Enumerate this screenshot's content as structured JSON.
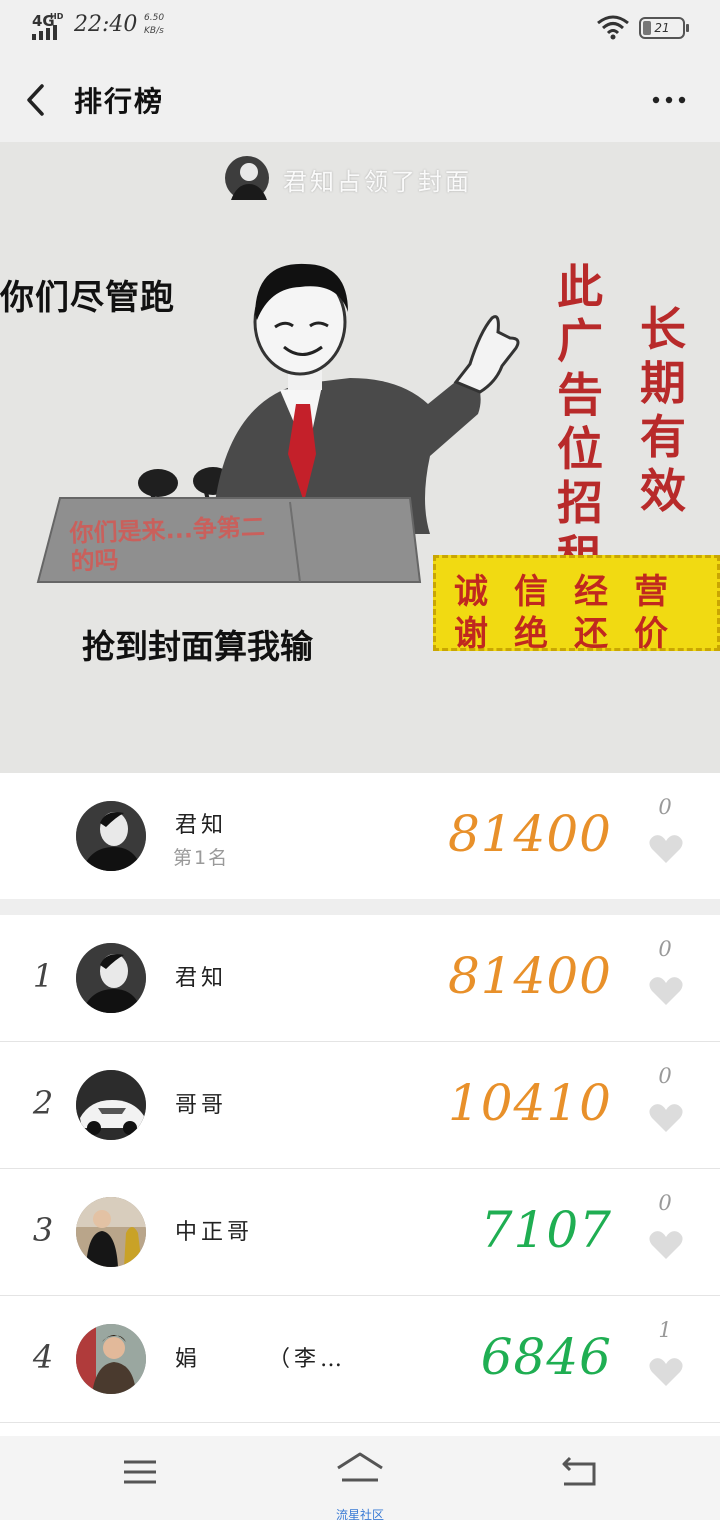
{
  "status_bar": {
    "network": "4G",
    "network_sub": "HD",
    "time": "22:40",
    "speed_value": "6.50",
    "speed_unit": "KB/s",
    "battery": "21"
  },
  "header": {
    "title": "排行榜",
    "back_icon": "chevron-left-icon",
    "more_icon": "more-dots-icon"
  },
  "cover": {
    "owner_note": "君知占领了封面",
    "meme_left_text": "你们尽管跑",
    "meme_podium_text": "你们是来...争第二的吗",
    "meme_bottom_text": "抢到封面算我输",
    "vertical_text_1": "此广告位招租",
    "vertical_text_2": "长期有效",
    "yellow_line_1": "诚信经营",
    "yellow_line_2": "谢绝还价"
  },
  "featured": {
    "name": "君知",
    "subtitle": "第1名",
    "score": "81400",
    "likes": "0",
    "score_color": "#e8902a"
  },
  "leaderboard": [
    {
      "rank": "1",
      "name": "君知",
      "score": "81400",
      "likes": "0",
      "score_color": "#e8902a"
    },
    {
      "rank": "2",
      "name": "哥哥",
      "score": "10410",
      "likes": "0",
      "score_color": "#e8902a"
    },
    {
      "rank": "3",
      "name": "中正哥",
      "score": "7107",
      "likes": "0",
      "score_color": "#1fae52"
    },
    {
      "rank": "4",
      "name": "娟　　　（李…",
      "score": "6846",
      "likes": "1",
      "score_color": "#1fae52"
    }
  ],
  "bottom_nav": {
    "label": "流星社区",
    "menu_icon": "menu-icon",
    "home_icon": "home-icon",
    "back_icon": "return-icon"
  },
  "colors": {
    "heart": "#dcdcdc",
    "accent_orange": "#e8902a",
    "accent_green": "#1fae52"
  }
}
